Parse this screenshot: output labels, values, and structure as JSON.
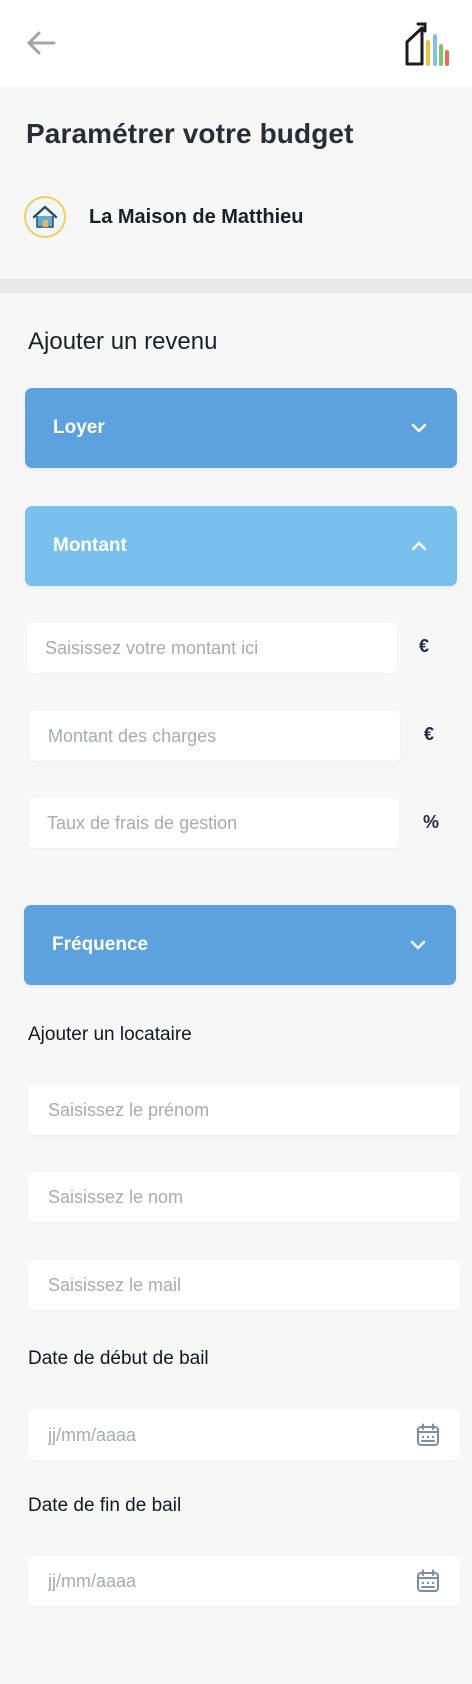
{
  "header": {
    "back_icon": "arrow-left-icon",
    "logo_icon": "house-bars-logo"
  },
  "page": {
    "title": "Paramétrer votre budget",
    "property_name": "La Maison de Matthieu",
    "property_icon": "house-icon"
  },
  "revenue": {
    "section_title": "Ajouter un revenu",
    "category_label": "Loyer",
    "amount_section_label": "Montant",
    "amount_placeholder": "Saisissez votre montant ici",
    "amount_unit": "€",
    "charges_placeholder": "Montant des charges",
    "charges_unit": "€",
    "fees_placeholder": "Taux de frais de gestion",
    "fees_unit": "%",
    "frequency_label": "Fréquence"
  },
  "tenant": {
    "section_title": "Ajouter un locataire",
    "firstname_placeholder": "Saisissez le prénom",
    "lastname_placeholder": "Saisissez le nom",
    "email_placeholder": "Saisissez le mail",
    "start_label": "Date de début de bail",
    "start_placeholder": "jj/mm/aaaa",
    "end_label": "Date de fin de bail",
    "end_placeholder": "jj/mm/aaaa"
  },
  "colors": {
    "accordion_dark": "#5ba2de",
    "accordion_light": "#78c1ec",
    "avatar_ring": "#f5cf56"
  }
}
